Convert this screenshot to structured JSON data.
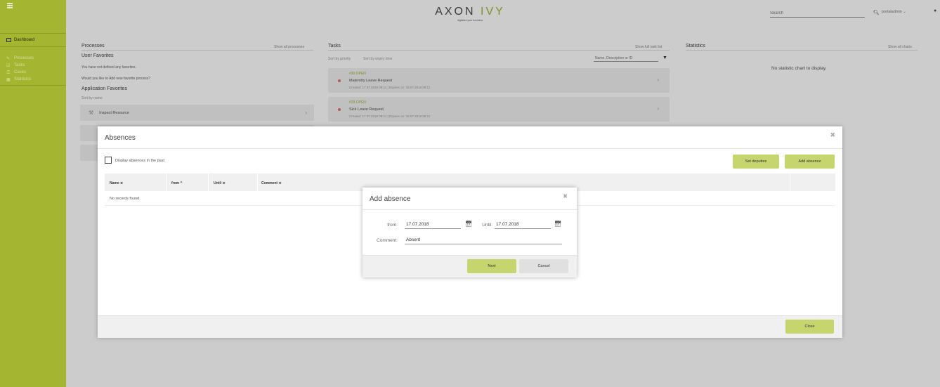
{
  "header": {
    "logo_text": "AXON",
    "logo_accent": "IVY",
    "logo_tagline": "digitalize your business",
    "search_placeholder": "Search",
    "user_label": "portaladmin"
  },
  "sidebar": {
    "dashboard_label": "Dashboard",
    "items": [
      {
        "label": "Processes",
        "icon": "pencil-icon"
      },
      {
        "label": "Tasks",
        "icon": "check-square-icon"
      },
      {
        "label": "Cases",
        "icon": "list-icon"
      },
      {
        "label": "Statistics",
        "icon": "calendar-icon"
      }
    ]
  },
  "processes": {
    "title": "Processes",
    "show_all": "Show all processes",
    "user_favorites": "User Favorites",
    "no_favorites": "You have not defined any favorites.",
    "add_prompt": "Would you like to Add new favorite process?",
    "app_favorites": "Application Favorites",
    "sort_by": "Sort by name",
    "items": [
      {
        "label": "Inspect Resource"
      }
    ]
  },
  "tasks": {
    "title": "Tasks",
    "show_full": "Show full task list",
    "sort_priority": "Sort by priority",
    "sort_expiry": "Sort by expiry time",
    "filter_placeholder": "Name, Description or ID",
    "items": [
      {
        "state": "#30 OPEN",
        "name": "Maternity Leave Request",
        "meta": "Created: 17.07.2018 09:11 | Expires on: 18.07.2018 09:11"
      },
      {
        "state": "#29 OPEN",
        "name": "Sick Leave Request",
        "meta": "Created: 17.07.2018 09:11 | Expires on: 18.07.2018 09:11"
      }
    ]
  },
  "statistics": {
    "title": "Statistics",
    "show_all": "Show all charts",
    "empty": "No statistic chart to display."
  },
  "absences": {
    "title": "Absences",
    "display_past_label": "Display absences in the past",
    "set_deputies": "Set deputies",
    "add_absence": "Add absence",
    "columns": [
      "Name ≎",
      "from ^",
      "Until ≎",
      "Comment ≎"
    ],
    "no_records": "No records found.",
    "close": "Close"
  },
  "add_absence": {
    "title": "Add absence",
    "from_label": "from:",
    "from_value": "17.07.2018",
    "until_label": "Until:",
    "until_value": "17.07.2018",
    "comment_label": "Comment:",
    "comment_value": "Absent",
    "next": "Next",
    "cancel": "Cancel"
  },
  "colors": {
    "brand": "#a3b531",
    "button_green": "#c7d56f"
  }
}
